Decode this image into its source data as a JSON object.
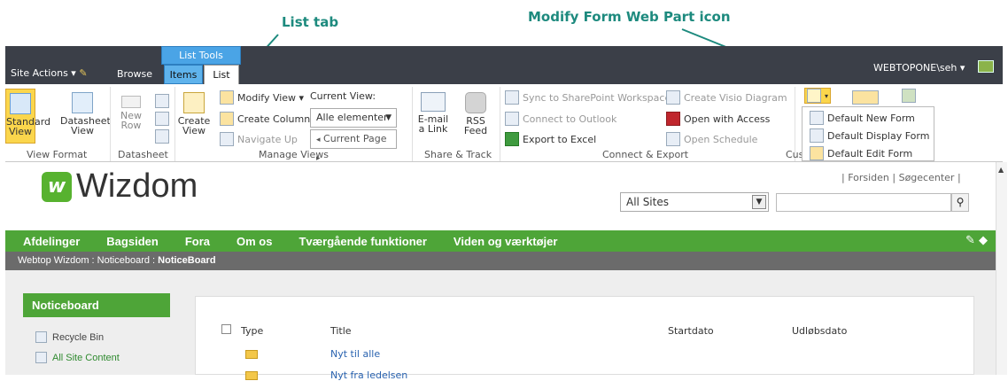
{
  "callouts": {
    "list_tab": "List tab",
    "modify_form": "Modify Form Web Part icon"
  },
  "topbar": {
    "list_tools": "List Tools",
    "site_actions": "Site Actions ▾",
    "browse": "Browse",
    "tab_items": "Items",
    "tab_list": "List",
    "user": "WEBTOPONE\\seh ▾"
  },
  "ribbon": {
    "view_format": {
      "label": "View Format",
      "standard": "Standard View",
      "datasheet": "Datasheet View"
    },
    "datasheet": {
      "label": "Datasheet",
      "new_row": "New Row"
    },
    "manage_views": {
      "label": "Manage Views",
      "create_view": "Create View",
      "modify_view": "Modify View ▾",
      "create_column": "Create Column",
      "navigate_up": "Navigate Up",
      "current_view_label": "Current View:",
      "current_view_value": "Alle elementer",
      "current_page": "Current Page"
    },
    "share_track": {
      "label": "Share & Track",
      "email_link": "E-mail a Link",
      "rss_feed": "RSS Feed"
    },
    "connect_export": {
      "label": "Connect & Export",
      "sync": "Sync to SharePoint Workspace",
      "connect_outlook": "Connect to Outlook",
      "export_excel": "Export to Excel",
      "create_visio": "Create Visio Diagram",
      "open_access": "Open with Access",
      "open_schedule": "Open Schedule"
    },
    "customize": {
      "label": "Cust",
      "menu": [
        "Default New Form",
        "Default Display Form",
        "Default Edit Form"
      ]
    }
  },
  "site": {
    "logo": "Wizdom",
    "logo_mark": "w",
    "top_links": "| Forsiden | Søgecenter |",
    "scope": "All Sites",
    "nav": [
      "Afdelinger",
      "Bagsiden",
      "Fora",
      "Om os",
      "Tværgående funktioner",
      "Viden og værktøjer"
    ],
    "breadcrumb_path": "Webtop Wizdom : Noticeboard : ",
    "breadcrumb_current": "NoticeBoard",
    "quicklaunch_title": "Noticeboard",
    "recycle_bin": "Recycle Bin",
    "all_site_content": "All Site Content"
  },
  "list": {
    "columns": [
      "Type",
      "Title",
      "Startdato",
      "Udløbsdato"
    ],
    "rows": [
      "Nyt til alle",
      "Nyt fra ledelsen"
    ]
  }
}
